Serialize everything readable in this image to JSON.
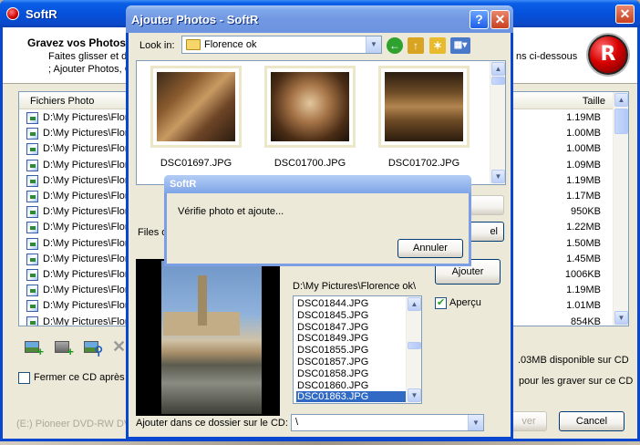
{
  "main": {
    "title": "SoftR",
    "header": {
      "heading": "Gravez vos Photos",
      "line1": "Faites glisser et dé",
      "line2": "; Ajouter Photos, C",
      "line1_right": "ns ci-dessous"
    },
    "logo_letter": "R",
    "list": {
      "col_files": "Fichiers Photo",
      "col_size": "Taille",
      "rows": [
        {
          "path": "D:\\My Pictures\\Flor",
          "size": "1.19MB"
        },
        {
          "path": "D:\\My Pictures\\Flor",
          "size": "1.00MB"
        },
        {
          "path": "D:\\My Pictures\\Flor",
          "size": "1.00MB"
        },
        {
          "path": "D:\\My Pictures\\Flor",
          "size": "1.09MB"
        },
        {
          "path": "D:\\My Pictures\\Flor",
          "size": "1.19MB"
        },
        {
          "path": "D:\\My Pictures\\Flor",
          "size": "1.17MB"
        },
        {
          "path": "D:\\My Pictures\\Flor",
          "size": "950KB"
        },
        {
          "path": "D:\\My Pictures\\Flor",
          "size": "1.22MB"
        },
        {
          "path": "D:\\My Pictures\\Flor",
          "size": "1.50MB"
        },
        {
          "path": "D:\\My Pictures\\Flor",
          "size": "1.45MB"
        },
        {
          "path": "D:\\My Pictures\\Flor",
          "size": "1006KB"
        },
        {
          "path": "D:\\My Pictures\\Flor",
          "size": "1.19MB"
        },
        {
          "path": "D:\\My Pictures\\Flor",
          "size": "1.01MB"
        },
        {
          "path": "D:\\My Pictures\\Flor",
          "size": "854KB"
        }
      ]
    },
    "disk_info": ".03MB disponible sur CD",
    "close_checkbox_label": "Fermer ce CD après l'",
    "burn_info": "pour les graver sur ce CD",
    "drive": "(E:) Pioneer DVD-RW DV",
    "burn_button": "ver",
    "cancel_button": "Cancel"
  },
  "dialog": {
    "title": "Ajouter Photos - SoftR",
    "look_in_label": "Look in:",
    "look_in_value": "Florence ok",
    "thumbnails": [
      {
        "name": "DSC01697.JPG"
      },
      {
        "name": "DSC01700.JPG"
      },
      {
        "name": "DSC01702.JPG"
      }
    ],
    "files_label": "Files o",
    "add_button": "Ajouter",
    "hidden_button_right": "el",
    "current_path": "D:\\My Pictures\\Florence ok\\",
    "preview_checkbox_label": "Aperçu",
    "file_list": [
      "DSC01844.JPG",
      "DSC01845.JPG",
      "DSC01847.JPG",
      "DSC01849.JPG",
      "DSC01855.JPG",
      "DSC01857.JPG",
      "DSC01858.JPG",
      "DSC01860.JPG",
      "DSC01863.JPG"
    ],
    "selected_file": "DSC01863.JPG",
    "dest_label": "Ajouter dans ce dossier sur le CD:",
    "dest_value": "\\"
  },
  "progress": {
    "title": "SoftR",
    "message": "Vérifie photo et ajoute...",
    "cancel_button": "Annuler"
  },
  "colors": {
    "xp_blue": "#0a47d1",
    "selection": "#316ac5"
  }
}
